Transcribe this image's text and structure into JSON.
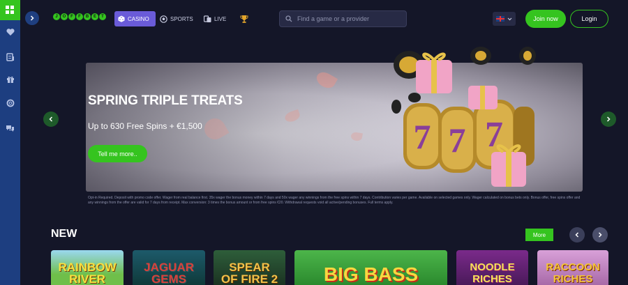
{
  "header": {
    "logo_letters": [
      "J",
      "O",
      "F",
      "F",
      "B",
      "E",
      "T"
    ],
    "nav": {
      "casino": "CASINO",
      "sports": "SPORTS",
      "live": "LIVE"
    },
    "search_placeholder": "Find a game or a provider",
    "join_label": "Join now",
    "login_label": "Login"
  },
  "sidebar": {
    "icons": [
      "heart-icon",
      "receipt-icon",
      "gift-icon",
      "lifebuoy-icon",
      "chat-icon"
    ]
  },
  "banner": {
    "title": "SPRING TRIPLE TREATS",
    "subtitle": "Up to 630 Free Spins + €1,500",
    "cta": "Tell me more..",
    "terms": "Opt-in Required. Deposit with promo code offer. Wager from real balance first. 35x wager the bonus money within 7 days and 50x wager any winnings from the free spins within 7 days. Contribution varies per game. Available on selected games only. Wager calculated on bonus bets only. Bonus offer, free spins offer and any winnings from the offer are valid for 7 days from receipt. Max conversion: 3 times the bonus amount or from free spins €20. Withdrawal requests void all active/pending bonuses. Full terms apply."
  },
  "new_section": {
    "title": "NEW",
    "more_label": "More",
    "games": [
      {
        "line1": "RAINBOW",
        "line2": "RIVER"
      },
      {
        "line1": "JAGUAR",
        "line2": "GEMS"
      },
      {
        "line1": "SPEAR",
        "line2": "OF FIRE 2"
      },
      {
        "line1": "BIG BASS",
        "line2": ""
      },
      {
        "line1": "NOODLE",
        "line2": "RICHES"
      },
      {
        "line1": "RACCOON",
        "line2": "RICHES"
      }
    ]
  },
  "colors": {
    "background": "#141628",
    "accent_green": "#35c41f",
    "sidebar_blue": "#1d3e80",
    "casino_tab": "#6a5bd8"
  }
}
